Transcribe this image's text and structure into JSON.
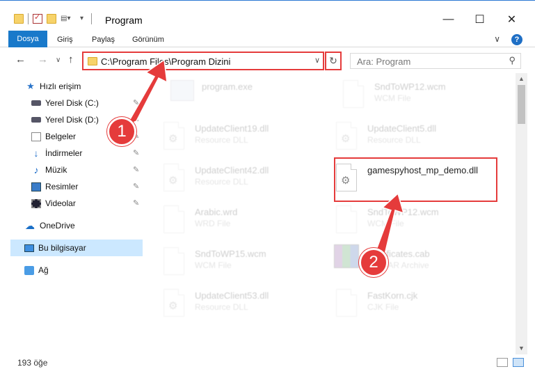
{
  "window": {
    "title": "Program",
    "minimize": "—",
    "maximize": "☐",
    "close": "✕"
  },
  "ribbon": {
    "tabs": [
      "Dosya",
      "Giriş",
      "Paylaş",
      "Görünüm"
    ],
    "expand": "∨",
    "help": "?"
  },
  "nav": {
    "back": "←",
    "forward": "→",
    "recent": "∨",
    "up": "↑",
    "address": "C:\\Program Files\\Program Dizini",
    "address_dropdown": "∨",
    "refresh": "↻",
    "search_placeholder": "Ara: Program",
    "search_icon": "⚲"
  },
  "sidebar": {
    "items": [
      {
        "label": "Hızlı erişim",
        "icon": "star-icon"
      },
      {
        "label": "Yerel Disk (C:)",
        "icon": "drive-icon",
        "pinned": true
      },
      {
        "label": "Yerel Disk (D:)",
        "icon": "drive-icon",
        "pinned": true
      },
      {
        "label": "Belgeler",
        "icon": "documents-icon",
        "pinned": true
      },
      {
        "label": "İndirmeler",
        "icon": "downloads-icon",
        "pinned": true
      },
      {
        "label": "Müzik",
        "icon": "music-icon",
        "pinned": true
      },
      {
        "label": "Resimler",
        "icon": "pictures-icon",
        "pinned": true
      },
      {
        "label": "Videolar",
        "icon": "videos-icon",
        "pinned": true
      },
      {
        "label": "OneDrive",
        "icon": "onedrive-icon"
      },
      {
        "label": "Bu bilgisayar",
        "icon": "this-pc-icon",
        "selected": true
      },
      {
        "label": "Ağ",
        "icon": "network-icon"
      }
    ],
    "pin_glyph": "📌"
  },
  "files": [
    {
      "name": "program.exe",
      "type": "",
      "icon": "exe-icon"
    },
    {
      "name": "SndToWP12.wcm",
      "type": "WCM File",
      "icon": "generic-file-icon"
    },
    {
      "name": "UpdateClient19.dll",
      "type": "Resource DLL",
      "icon": "dll-icon"
    },
    {
      "name": "UpdateClient5.dll",
      "type": "Resource DLL",
      "icon": "dll-icon"
    },
    {
      "name": "UpdateClient42.dll",
      "type": "Resource DLL",
      "icon": "dll-icon"
    },
    {
      "name": "gamespyhost_mp_demo.dll",
      "type": "",
      "icon": "dll-icon",
      "highlighted": true
    },
    {
      "name": "Arabic.wrd",
      "type": "WRD File",
      "icon": "generic-file-icon"
    },
    {
      "name": "SndToWP12.wcm",
      "type": "WCM File",
      "icon": "generic-file-icon"
    },
    {
      "name": "SndToWP15.wcm",
      "type": "WCM File",
      "icon": "generic-file-icon"
    },
    {
      "name": "Certificates.cab",
      "type": "WinRAR Archive",
      "icon": "winrar-icon"
    },
    {
      "name": "UpdateClient53.dll",
      "type": "Resource DLL",
      "icon": "dll-icon"
    },
    {
      "name": "FastKorn.cjk",
      "type": "CJK File",
      "icon": "generic-file-icon"
    }
  ],
  "status": {
    "item_count": "193 öğe"
  },
  "callouts": [
    "1",
    "2"
  ]
}
